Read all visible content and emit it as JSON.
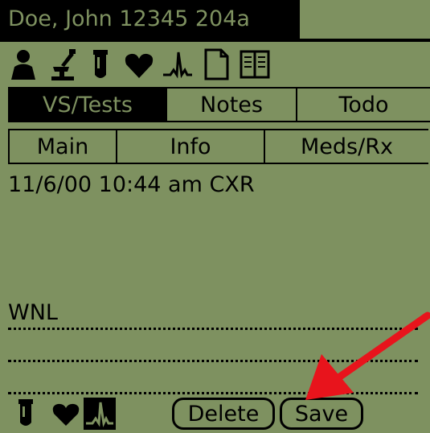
{
  "header": {
    "patient_title": "Doe, John 12345 204a"
  },
  "icon_row": [
    "person-icon",
    "microscope-icon",
    "test-tube-icon",
    "heart-icon",
    "ecg-icon",
    "document-icon",
    "book-icon"
  ],
  "tabs_row1": [
    {
      "label": "VS/Tests",
      "active": true
    },
    {
      "label": "Notes",
      "active": false
    },
    {
      "label": "Todo",
      "active": false
    }
  ],
  "tabs_row2": [
    {
      "label": "Main"
    },
    {
      "label": "Info"
    },
    {
      "label": "Meds/Rx"
    }
  ],
  "entry": {
    "timestamp_line": "11/6/00 10:44 am CXR"
  },
  "note": {
    "text": "WNL"
  },
  "bottom_bar": {
    "icons": [
      "test-tube-icon",
      "heart-icon",
      "ecg-icon"
    ],
    "delete_label": "Delete",
    "save_label": "Save"
  },
  "colors": {
    "lcd_background": "#7e9160",
    "foreground": "#000000",
    "annotation_arrow": "#e8141c"
  }
}
